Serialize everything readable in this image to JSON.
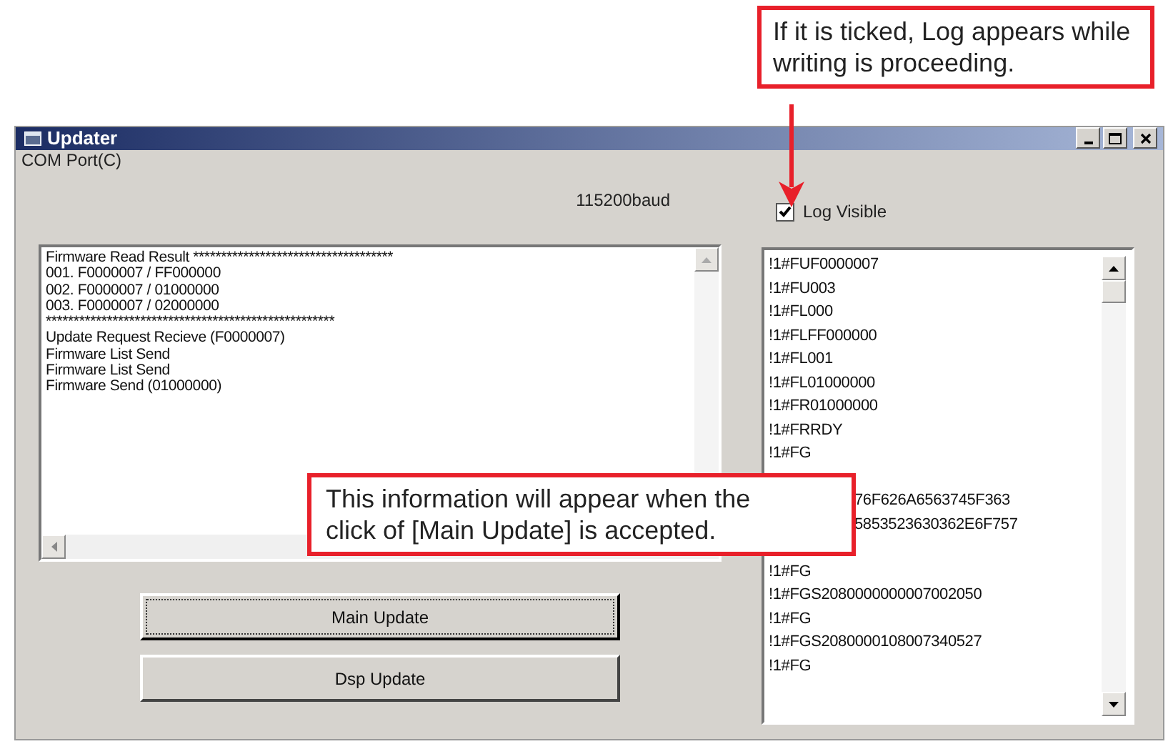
{
  "window": {
    "title": "Updater"
  },
  "menu": {
    "label": "COM Port(C)"
  },
  "baud": "115200baud",
  "log_visible": {
    "label": "Log Visible",
    "checked": true
  },
  "result_log": {
    "lines": [
      "Firmware Read Result ************************************",
      "001. F0000007 / FF000000",
      "002. F0000007 / 01000000",
      "003. F0000007 / 02000000",
      "****************************************************",
      "Update Request Recieve (F0000007)",
      "Firmware List Send",
      "Firmware List Send",
      "Firmware Send (01000000)"
    ]
  },
  "buttons": [
    {
      "label": "Main Update",
      "focused": true
    },
    {
      "label": "Dsp Update",
      "focused": false
    }
  ],
  "protocol_log": {
    "lines": [
      {
        "text": "!1#FUF0000007",
        "kind": "full"
      },
      {
        "text": "!1#FU003",
        "kind": "full"
      },
      {
        "text": "!1#FL000",
        "kind": "full"
      },
      {
        "text": "!1#FLFF000000",
        "kind": "full"
      },
      {
        "text": "!1#FL001",
        "kind": "full"
      },
      {
        "text": "!1#FL01000000",
        "kind": "full"
      },
      {
        "text": "!1#FR01000000",
        "kind": "full"
      },
      {
        "text": "!1#FRRDY",
        "kind": "full"
      },
      {
        "text": "!1#FG",
        "kind": "full"
      },
      {
        "text": "76F626A6563745F363",
        "kind": "covered"
      },
      {
        "text": "5853523630362E6F757",
        "kind": "covered"
      },
      {
        "text": "!1#FG",
        "kind": "full"
      },
      {
        "text": "!1#FGS2080000000007002050",
        "kind": "full"
      },
      {
        "text": "!1#FG",
        "kind": "full"
      },
      {
        "text": "!1#FGS2080000108007340527",
        "kind": "full"
      },
      {
        "text": "!1#FG",
        "kind": "full"
      }
    ]
  },
  "callouts": [
    {
      "text": "If it is ticked, Log appears while writing is proceeding.",
      "kind": "arrow"
    },
    {
      "text": "This information will appear when the click of [Main Update] is accepted.",
      "kind": "plain"
    }
  ]
}
